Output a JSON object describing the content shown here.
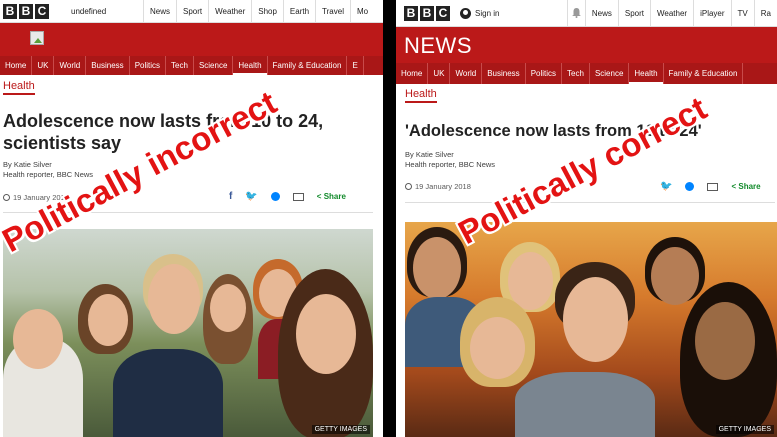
{
  "left": {
    "topnav": [
      "News",
      "Sport",
      "Weather",
      "Shop",
      "Earth",
      "Travel",
      "Mo"
    ],
    "undefined_text": "undefined",
    "sections": [
      "Home",
      "UK",
      "World",
      "Business",
      "Politics",
      "Tech",
      "Science",
      "Health",
      "Family & Education",
      "E"
    ],
    "section_label": "Health",
    "headline": "Adolescence now lasts from 10 to 24, scientists say",
    "byline_author": "By Katie Silver",
    "byline_role": "Health reporter, BBC News",
    "date": "19 January 2018",
    "share_label": "Share",
    "photo_credit": "GETTY IMAGES",
    "overlay": "Politically incorrect"
  },
  "right": {
    "signin": "Sign in",
    "topnav": [
      "News",
      "Sport",
      "Weather",
      "iPlayer",
      "TV",
      "Ra"
    ],
    "banner_title": "NEWS",
    "sections": [
      "Home",
      "UK",
      "World",
      "Business",
      "Politics",
      "Tech",
      "Science",
      "Health",
      "Family & Education"
    ],
    "section_label": "Health",
    "headline": "'Adolescence now lasts from 10 to 24'",
    "byline_author": "By Katie Silver",
    "byline_role": "Health reporter, BBC News",
    "date": "19 January 2018",
    "share_label": "Share",
    "photo_credit": "GETTY IMAGES",
    "overlay": "Politically correct"
  },
  "logo_letters": [
    "B",
    "B",
    "C"
  ],
  "colors": {
    "bbc_red": "#bb1919",
    "overlay_red": "#e31313"
  }
}
